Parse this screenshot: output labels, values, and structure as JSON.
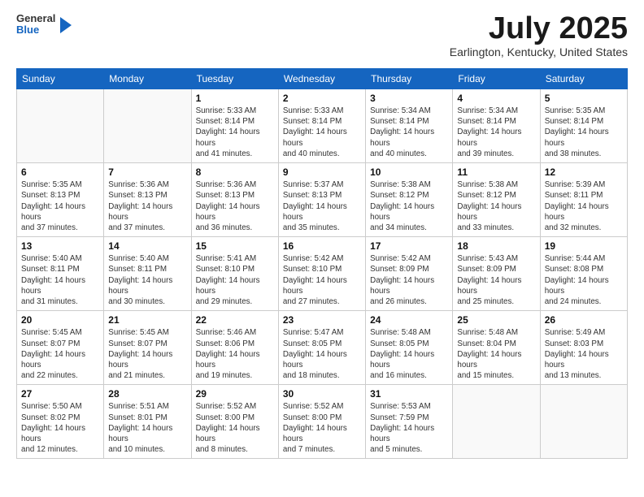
{
  "header": {
    "logo": {
      "line1": "General",
      "line2": "Blue"
    },
    "title": "July 2025",
    "location": "Earlington, Kentucky, United States"
  },
  "days_of_week": [
    "Sunday",
    "Monday",
    "Tuesday",
    "Wednesday",
    "Thursday",
    "Friday",
    "Saturday"
  ],
  "weeks": [
    [
      {
        "day": "",
        "empty": true
      },
      {
        "day": "",
        "empty": true
      },
      {
        "day": "1",
        "sunrise": "Sunrise: 5:33 AM",
        "sunset": "Sunset: 8:14 PM",
        "daylight": "Daylight: 14 hours and 41 minutes."
      },
      {
        "day": "2",
        "sunrise": "Sunrise: 5:33 AM",
        "sunset": "Sunset: 8:14 PM",
        "daylight": "Daylight: 14 hours and 40 minutes."
      },
      {
        "day": "3",
        "sunrise": "Sunrise: 5:34 AM",
        "sunset": "Sunset: 8:14 PM",
        "daylight": "Daylight: 14 hours and 40 minutes."
      },
      {
        "day": "4",
        "sunrise": "Sunrise: 5:34 AM",
        "sunset": "Sunset: 8:14 PM",
        "daylight": "Daylight: 14 hours and 39 minutes."
      },
      {
        "day": "5",
        "sunrise": "Sunrise: 5:35 AM",
        "sunset": "Sunset: 8:14 PM",
        "daylight": "Daylight: 14 hours and 38 minutes."
      }
    ],
    [
      {
        "day": "6",
        "sunrise": "Sunrise: 5:35 AM",
        "sunset": "Sunset: 8:13 PM",
        "daylight": "Daylight: 14 hours and 37 minutes."
      },
      {
        "day": "7",
        "sunrise": "Sunrise: 5:36 AM",
        "sunset": "Sunset: 8:13 PM",
        "daylight": "Daylight: 14 hours and 37 minutes."
      },
      {
        "day": "8",
        "sunrise": "Sunrise: 5:36 AM",
        "sunset": "Sunset: 8:13 PM",
        "daylight": "Daylight: 14 hours and 36 minutes."
      },
      {
        "day": "9",
        "sunrise": "Sunrise: 5:37 AM",
        "sunset": "Sunset: 8:13 PM",
        "daylight": "Daylight: 14 hours and 35 minutes."
      },
      {
        "day": "10",
        "sunrise": "Sunrise: 5:38 AM",
        "sunset": "Sunset: 8:12 PM",
        "daylight": "Daylight: 14 hours and 34 minutes."
      },
      {
        "day": "11",
        "sunrise": "Sunrise: 5:38 AM",
        "sunset": "Sunset: 8:12 PM",
        "daylight": "Daylight: 14 hours and 33 minutes."
      },
      {
        "day": "12",
        "sunrise": "Sunrise: 5:39 AM",
        "sunset": "Sunset: 8:11 PM",
        "daylight": "Daylight: 14 hours and 32 minutes."
      }
    ],
    [
      {
        "day": "13",
        "sunrise": "Sunrise: 5:40 AM",
        "sunset": "Sunset: 8:11 PM",
        "daylight": "Daylight: 14 hours and 31 minutes."
      },
      {
        "day": "14",
        "sunrise": "Sunrise: 5:40 AM",
        "sunset": "Sunset: 8:11 PM",
        "daylight": "Daylight: 14 hours and 30 minutes."
      },
      {
        "day": "15",
        "sunrise": "Sunrise: 5:41 AM",
        "sunset": "Sunset: 8:10 PM",
        "daylight": "Daylight: 14 hours and 29 minutes."
      },
      {
        "day": "16",
        "sunrise": "Sunrise: 5:42 AM",
        "sunset": "Sunset: 8:10 PM",
        "daylight": "Daylight: 14 hours and 27 minutes."
      },
      {
        "day": "17",
        "sunrise": "Sunrise: 5:42 AM",
        "sunset": "Sunset: 8:09 PM",
        "daylight": "Daylight: 14 hours and 26 minutes."
      },
      {
        "day": "18",
        "sunrise": "Sunrise: 5:43 AM",
        "sunset": "Sunset: 8:09 PM",
        "daylight": "Daylight: 14 hours and 25 minutes."
      },
      {
        "day": "19",
        "sunrise": "Sunrise: 5:44 AM",
        "sunset": "Sunset: 8:08 PM",
        "daylight": "Daylight: 14 hours and 24 minutes."
      }
    ],
    [
      {
        "day": "20",
        "sunrise": "Sunrise: 5:45 AM",
        "sunset": "Sunset: 8:07 PM",
        "daylight": "Daylight: 14 hours and 22 minutes."
      },
      {
        "day": "21",
        "sunrise": "Sunrise: 5:45 AM",
        "sunset": "Sunset: 8:07 PM",
        "daylight": "Daylight: 14 hours and 21 minutes."
      },
      {
        "day": "22",
        "sunrise": "Sunrise: 5:46 AM",
        "sunset": "Sunset: 8:06 PM",
        "daylight": "Daylight: 14 hours and 19 minutes."
      },
      {
        "day": "23",
        "sunrise": "Sunrise: 5:47 AM",
        "sunset": "Sunset: 8:05 PM",
        "daylight": "Daylight: 14 hours and 18 minutes."
      },
      {
        "day": "24",
        "sunrise": "Sunrise: 5:48 AM",
        "sunset": "Sunset: 8:05 PM",
        "daylight": "Daylight: 14 hours and 16 minutes."
      },
      {
        "day": "25",
        "sunrise": "Sunrise: 5:48 AM",
        "sunset": "Sunset: 8:04 PM",
        "daylight": "Daylight: 14 hours and 15 minutes."
      },
      {
        "day": "26",
        "sunrise": "Sunrise: 5:49 AM",
        "sunset": "Sunset: 8:03 PM",
        "daylight": "Daylight: 14 hours and 13 minutes."
      }
    ],
    [
      {
        "day": "27",
        "sunrise": "Sunrise: 5:50 AM",
        "sunset": "Sunset: 8:02 PM",
        "daylight": "Daylight: 14 hours and 12 minutes."
      },
      {
        "day": "28",
        "sunrise": "Sunrise: 5:51 AM",
        "sunset": "Sunset: 8:01 PM",
        "daylight": "Daylight: 14 hours and 10 minutes."
      },
      {
        "day": "29",
        "sunrise": "Sunrise: 5:52 AM",
        "sunset": "Sunset: 8:00 PM",
        "daylight": "Daylight: 14 hours and 8 minutes."
      },
      {
        "day": "30",
        "sunrise": "Sunrise: 5:52 AM",
        "sunset": "Sunset: 8:00 PM",
        "daylight": "Daylight: 14 hours and 7 minutes."
      },
      {
        "day": "31",
        "sunrise": "Sunrise: 5:53 AM",
        "sunset": "Sunset: 7:59 PM",
        "daylight": "Daylight: 14 hours and 5 minutes."
      },
      {
        "day": "",
        "empty": true
      },
      {
        "day": "",
        "empty": true
      }
    ]
  ]
}
